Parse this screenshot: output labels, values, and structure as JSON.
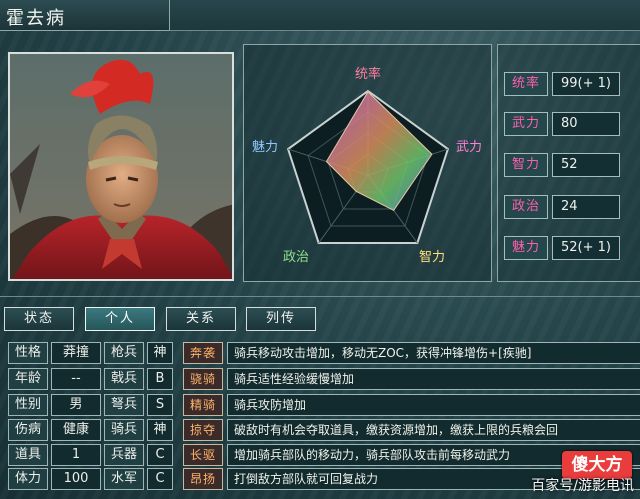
{
  "header": {
    "name": "霍去病"
  },
  "radar": {
    "labels": {
      "tongshuai": "统率",
      "wuli": "武力",
      "zhili": "智力",
      "zhengzhi": "政治",
      "meili": "魅力"
    },
    "values": {
      "tongshuai": 99,
      "wuli": 80,
      "zhili": 52,
      "zhengzhi": 24,
      "meili": 52
    }
  },
  "stats": [
    {
      "label": "统率",
      "value": "99(+ 1)"
    },
    {
      "label": "武力",
      "value": "80"
    },
    {
      "label": "智力",
      "value": "52"
    },
    {
      "label": "政治",
      "value": "24"
    },
    {
      "label": "魅力",
      "value": "52(+ 1)"
    }
  ],
  "tabs": [
    "状态",
    "个人",
    "关系",
    "列传"
  ],
  "active_tab": 1,
  "personal": {
    "rows": [
      {
        "k1": "性格",
        "v1": "莽撞",
        "k2": "枪兵",
        "v2": "神"
      },
      {
        "k1": "年龄",
        "v1": "--",
        "k2": "戟兵",
        "v2": "B"
      },
      {
        "k1": "性别",
        "v1": "男",
        "k2": "弩兵",
        "v2": "S"
      },
      {
        "k1": "伤病",
        "v1": "健康",
        "k2": "骑兵",
        "v2": "神"
      },
      {
        "k1": "道具",
        "v1": "1",
        "k2": "兵器",
        "v2": "C"
      },
      {
        "k1": "体力",
        "v1": "100",
        "k2": "水军",
        "v2": "C"
      }
    ]
  },
  "skills": [
    {
      "name": "奔袭",
      "desc": "骑兵移动攻击增加，移动无ZOC，获得冲锋增伤+[疾驰]"
    },
    {
      "name": "骁骑",
      "desc": "骑兵适性经验缓慢增加"
    },
    {
      "name": "精骑",
      "desc": "骑兵攻防增加"
    },
    {
      "name": "掠夺",
      "desc": "破敌时有机会夺取道具，缴获资源增加，缴获上限的兵粮会回"
    },
    {
      "name": "长驱",
      "desc": "增加骑兵部队的移动力，骑兵部队攻击前每移动武力"
    },
    {
      "name": "昂扬",
      "desc": "打倒敌方部队就可回复战力"
    }
  ],
  "watermark": {
    "text": "百家号/游影电讯",
    "logo": "傻大方"
  },
  "colors": {
    "stat_label": "#ff5fae",
    "skill_label": "#ffb36a"
  }
}
